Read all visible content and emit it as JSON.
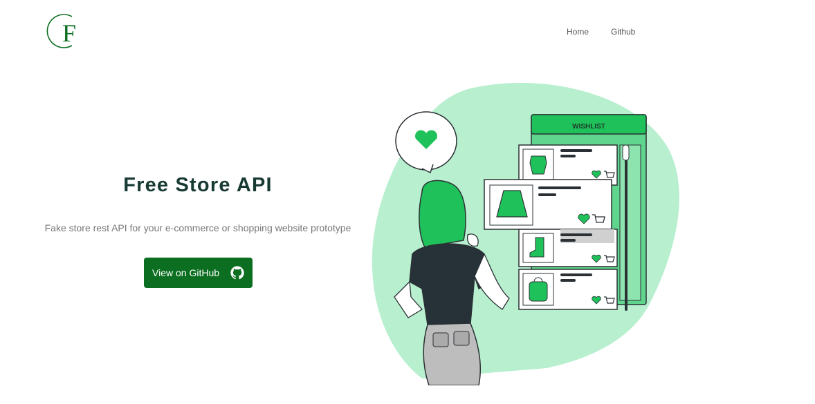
{
  "brand": {
    "logo_letter": "F"
  },
  "nav": {
    "home_label": "Home",
    "github_label": "Github"
  },
  "hero": {
    "title": "Free Store API",
    "subtitle": "Fake store rest API for your e-commerce or shopping website prototype",
    "cta_label": "View on GitHub"
  },
  "illustration": {
    "wishlist_title": "WISHLIST"
  },
  "colors": {
    "brand_green": "#0c6e20",
    "accent_green": "#1fc25a",
    "blob_green": "#b7efcf",
    "title_color": "#173a33"
  },
  "icons": [
    "logo-icon",
    "github-icon",
    "heart-icon",
    "cart-icon"
  ]
}
